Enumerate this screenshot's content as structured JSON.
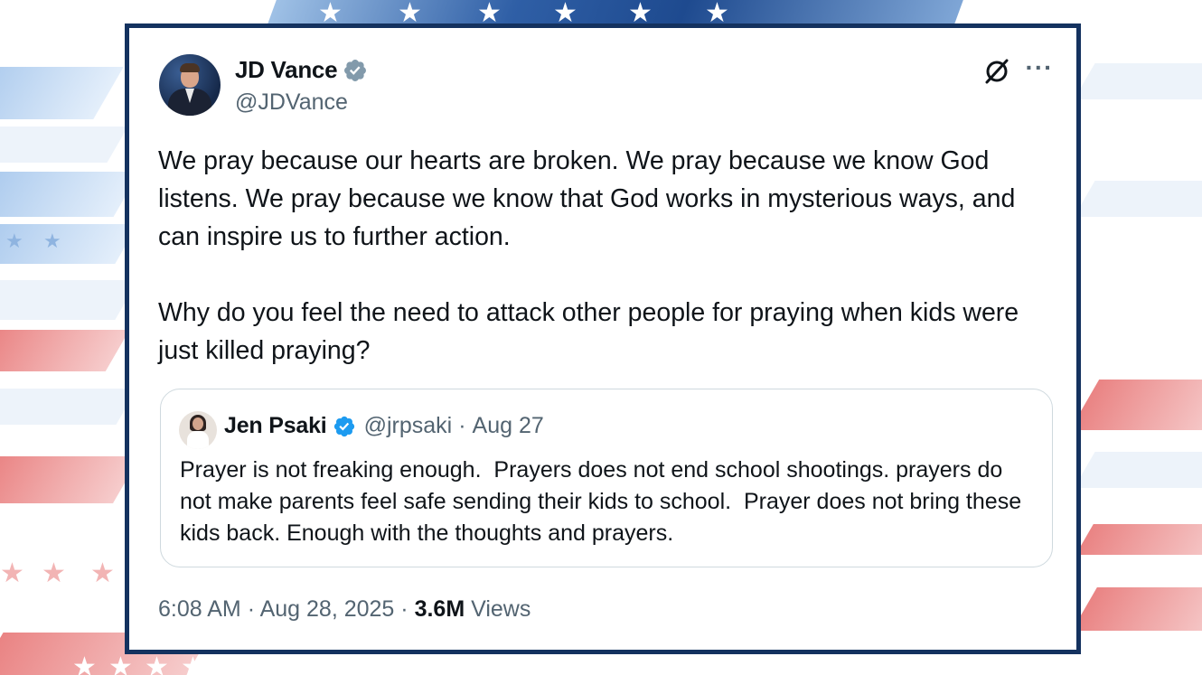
{
  "author": {
    "name": "JD Vance",
    "handle": "@JDVance",
    "verified": true
  },
  "tweet": {
    "paragraphs": [
      "We pray because our hearts are broken. We pray because we know God listens. We pray because we know that God works in mysterious ways, and can inspire us to further action.",
      "Why do you feel the need to attack other people for praying when kids were just killed praying?"
    ]
  },
  "quoted_tweet": {
    "name": "Jen Psaki",
    "handle": "@jrpsaki",
    "separator": "·",
    "date": "Aug 27",
    "verified": true,
    "text": "Prayer is not freaking enough.  Prayers does not end school shootings. prayers do not make parents feel safe sending their kids to school.  Prayer does not bring these kids back. Enough with the thoughts and prayers."
  },
  "meta": {
    "time": "6:08 AM",
    "separator": "·",
    "date": "Aug 28, 2025",
    "views_count": "3.6M",
    "views_label": "Views"
  },
  "icons": {
    "verified_badge": "verified-badge-icon",
    "grok": "grok-icon",
    "more": "more-options-icon",
    "more_glyph": "···"
  },
  "colors": {
    "card_border": "#14325f",
    "text_primary": "#0f1419",
    "text_secondary": "#536471",
    "verified_blue": "#1d9bf0",
    "verified_gray": "#829aab",
    "quote_border": "#cfd9de"
  }
}
